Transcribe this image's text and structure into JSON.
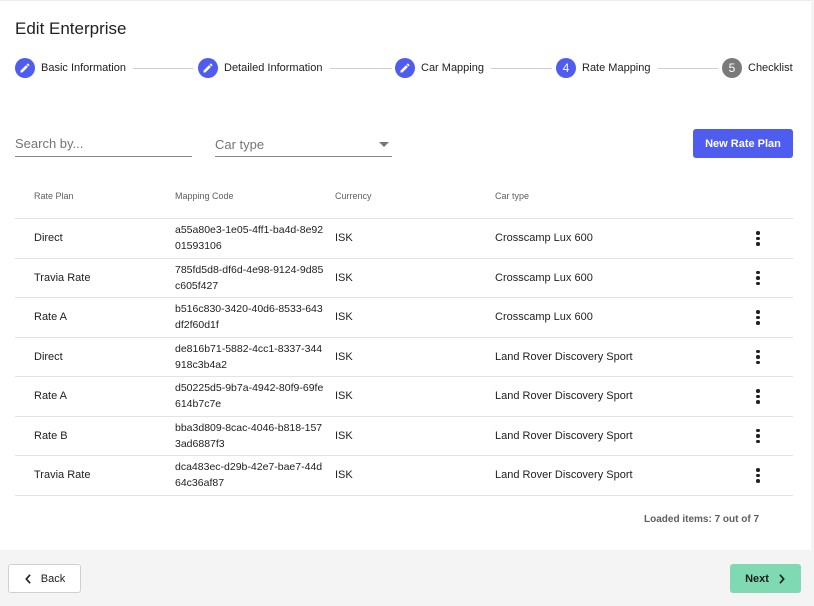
{
  "page": {
    "title": "Edit Enterprise"
  },
  "stepper": {
    "steps": [
      {
        "label": "Basic Information",
        "status": "edit",
        "icon": "pencil-icon"
      },
      {
        "label": "Detailed Information",
        "status": "edit",
        "icon": "pencil-icon"
      },
      {
        "label": "Car Mapping",
        "status": "edit",
        "icon": "pencil-icon"
      },
      {
        "label": "Rate Mapping",
        "status": "active",
        "number": "4"
      },
      {
        "label": "Checklist",
        "status": "inactive",
        "number": "5"
      }
    ]
  },
  "filters": {
    "search_placeholder": "Search by...",
    "car_type_value": "Car type"
  },
  "actions": {
    "new_rate_plan": "New Rate Plan"
  },
  "table": {
    "columns": [
      "Rate Plan",
      "Mapping Code",
      "Currency",
      "Car type"
    ],
    "rows": [
      {
        "rate_plan": "Direct",
        "mapping_code": "a55a80e3-1e05-4ff1-ba4d-8e9201593106",
        "currency": "ISK",
        "car_type": "Crosscamp Lux 600"
      },
      {
        "rate_plan": "Travia Rate",
        "mapping_code": "785fd5d8-df6d-4e98-9124-9d85c605f427",
        "currency": "ISK",
        "car_type": "Crosscamp Lux 600"
      },
      {
        "rate_plan": "Rate A",
        "mapping_code": "b516c830-3420-40d6-8533-643df2f60d1f",
        "currency": "ISK",
        "car_type": "Crosscamp Lux 600"
      },
      {
        "rate_plan": "Direct",
        "mapping_code": "de816b71-5882-4cc1-8337-344918c3b4a2",
        "currency": "ISK",
        "car_type": "Land Rover Discovery Sport"
      },
      {
        "rate_plan": "Rate A",
        "mapping_code": "d50225d5-9b7a-4942-80f9-69fe614b7c7e",
        "currency": "ISK",
        "car_type": "Land Rover Discovery Sport"
      },
      {
        "rate_plan": "Rate B",
        "mapping_code": "bba3d809-8cac-4046-b818-1573ad6887f3",
        "currency": "ISK",
        "car_type": "Land Rover Discovery Sport"
      },
      {
        "rate_plan": "Travia Rate",
        "mapping_code": "dca483ec-d29b-42e7-bae7-44d64c36af87",
        "currency": "ISK",
        "car_type": "Land Rover Discovery Sport"
      }
    ],
    "row_action_icon": "more-vertical-icon"
  },
  "footer": {
    "loaded_text": "Loaded items: 7 out of 7",
    "back_label": "Back",
    "next_label": "Next"
  },
  "colors": {
    "primary": "#4f5cf0",
    "step_inactive": "#7a7a7a",
    "next_button": "#7fd9b2"
  }
}
